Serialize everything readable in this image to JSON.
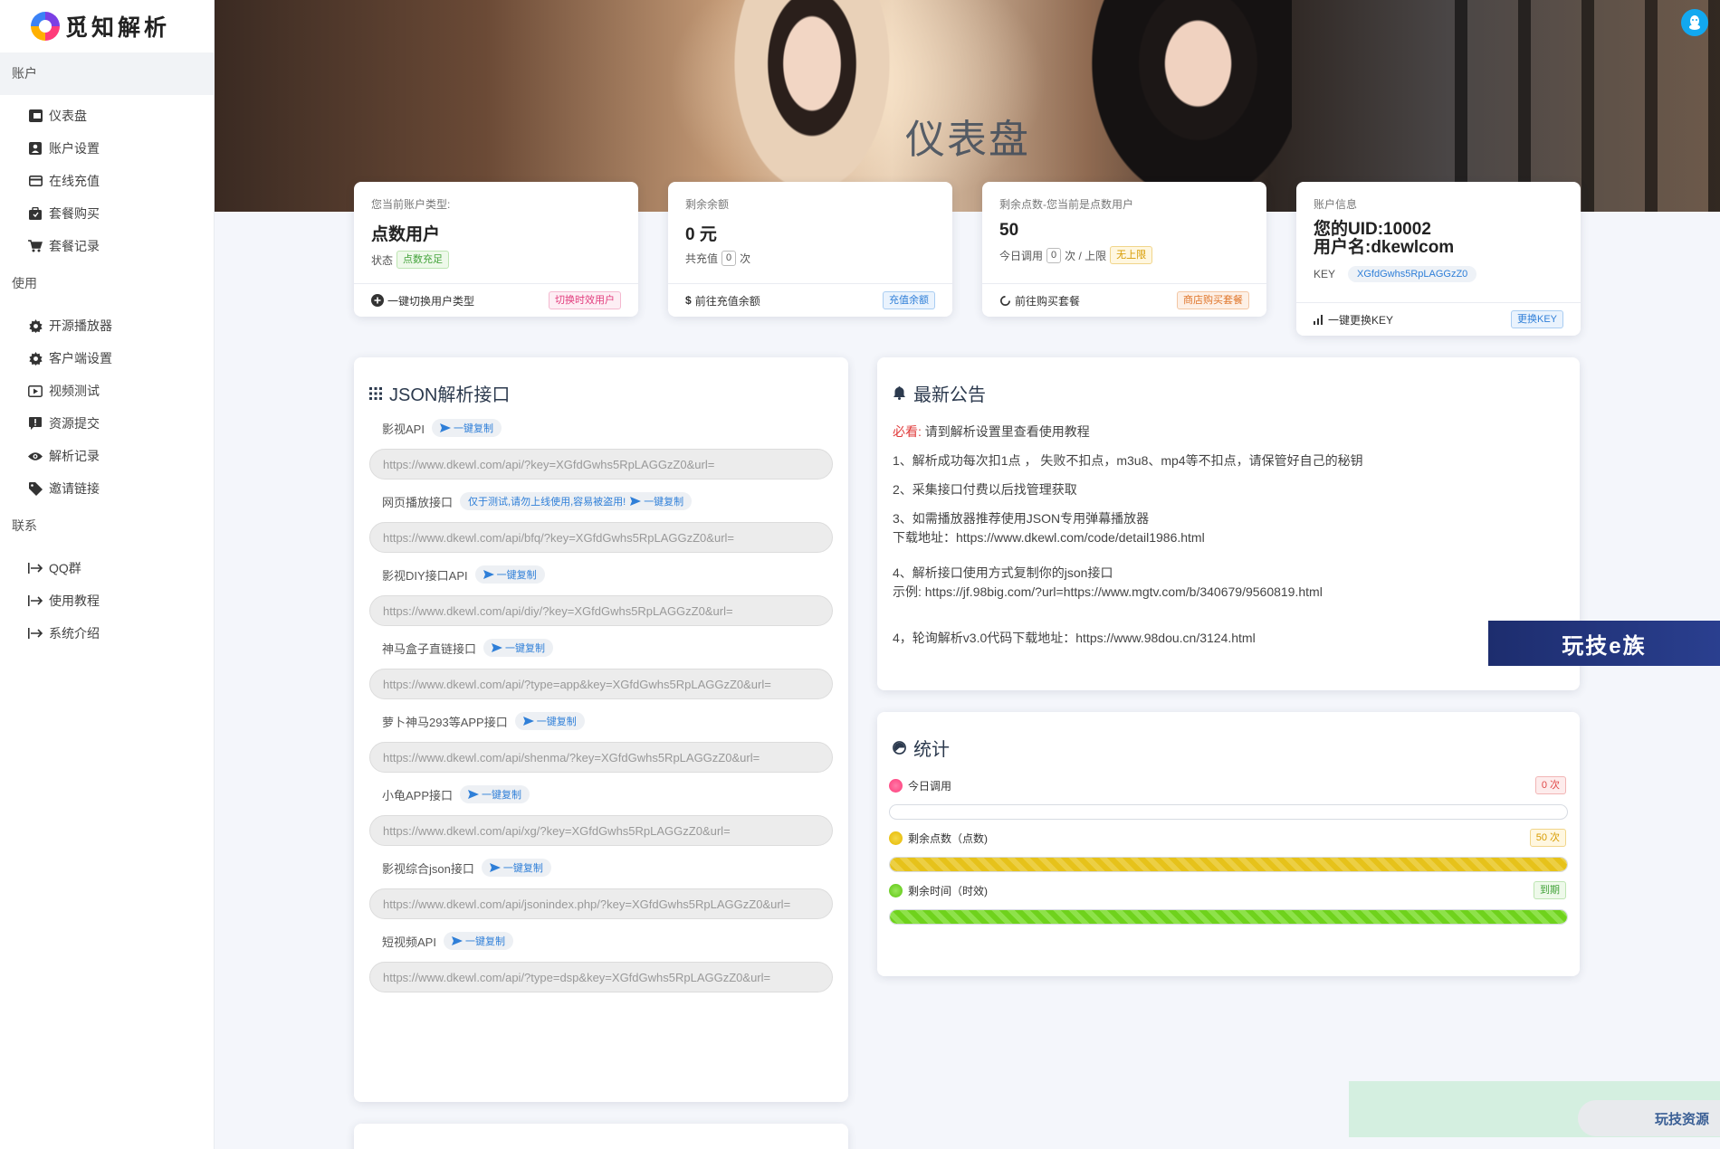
{
  "app": {
    "logo_text": "觅知解析"
  },
  "sidebar": {
    "sections": [
      {
        "label": "账户",
        "items": [
          {
            "label": "仪表盘",
            "icon": "dashboard-icon"
          },
          {
            "label": "账户设置",
            "icon": "user-icon"
          },
          {
            "label": "在线充值",
            "icon": "card-icon"
          },
          {
            "label": "套餐购买",
            "icon": "bag-icon"
          },
          {
            "label": "套餐记录",
            "icon": "cart-icon"
          }
        ]
      },
      {
        "label": "使用",
        "items": [
          {
            "label": "开源播放器",
            "icon": "gear-icon"
          },
          {
            "label": "客户端设置",
            "icon": "gear-icon"
          },
          {
            "label": "视频测试",
            "icon": "play-icon"
          },
          {
            "label": "资源提交",
            "icon": "alert-icon"
          },
          {
            "label": "解析记录",
            "icon": "eye-icon"
          },
          {
            "label": "邀请链接",
            "icon": "tag-icon"
          }
        ]
      },
      {
        "label": "联系",
        "items": [
          {
            "label": "QQ群",
            "icon": "arrow-right-icon"
          },
          {
            "label": "使用教程",
            "icon": "arrow-right-icon"
          },
          {
            "label": "系统介绍",
            "icon": "arrow-right-icon"
          }
        ]
      }
    ]
  },
  "banner": {
    "title": "仪表盘"
  },
  "cards": {
    "account_type": {
      "label": "您当前账户类型:",
      "value": "点数用户",
      "status_label": "状态",
      "status_tag": "点数充足",
      "footer_label": "一键切换用户类型",
      "footer_tag": "切换时效用户"
    },
    "balance": {
      "label": "剩余余额",
      "value": "0 元",
      "sub_prefix": "共充值",
      "sub_num": "0",
      "sub_suffix": "次",
      "footer_label": "前往充值余额",
      "footer_tag": "充值余额"
    },
    "points": {
      "label": "剩余点数-您当前是点数用户",
      "value": "50",
      "sub_prefix": "今日调用",
      "sub_num": "0",
      "sub_mid": "次 / 上限",
      "sub_tag": "无上限",
      "footer_label": "前往购买套餐",
      "footer_tag": "商店购买套餐"
    },
    "account_info": {
      "label": "账户信息",
      "uid_line": "您的UID:10002",
      "name_line": "用户名:dkewlcom",
      "key_label": "KEY",
      "key_value": "XGfdGwhs5RpLAGGzZ0",
      "footer_label": "一键更换KEY",
      "footer_tag": "更换KEY"
    }
  },
  "api": {
    "title": "JSON解析接口",
    "copy_label": "一键复制",
    "items": [
      {
        "name": "影视API",
        "note": "",
        "url": "https://www.dkewl.com/api/?key=XGfdGwhs5RpLAGGzZ0&url="
      },
      {
        "name": "网页播放接口",
        "note": "仅于测试,请勿上线使用,容易被盗用!",
        "url": "https://www.dkewl.com/api/bfq/?key=XGfdGwhs5RpLAGGzZ0&url="
      },
      {
        "name": "影视DIY接口API",
        "note": "",
        "url": "https://www.dkewl.com/api/diy/?key=XGfdGwhs5RpLAGGzZ0&url="
      },
      {
        "name": "神马盒子直链接口",
        "note": "",
        "url": "https://www.dkewl.com/api/?type=app&key=XGfdGwhs5RpLAGGzZ0&url="
      },
      {
        "name": "萝卜神马293等APP接口",
        "note": "",
        "url": "https://www.dkewl.com/api/shenma/?key=XGfdGwhs5RpLAGGzZ0&url="
      },
      {
        "name": "小龟APP接口",
        "note": "",
        "url": "https://www.dkewl.com/api/xg/?key=XGfdGwhs5RpLAGGzZ0&url="
      },
      {
        "name": "影视综合json接口",
        "note": "",
        "url": "https://www.dkewl.com/api/jsonindex.php/?key=XGfdGwhs5RpLAGGzZ0&url="
      },
      {
        "name": "短视频API",
        "note": "",
        "url": "https://www.dkewl.com/api/?type=dsp&key=XGfdGwhs5RpLAGGzZ0&url="
      }
    ]
  },
  "notice": {
    "title": "最新公告",
    "must_label": "必看:",
    "must_text": "请到解析设置里查看使用教程",
    "line1": "1、解析成功每次扣1点 ， 失败不扣点，m3u8、mp4等不扣点，请保管好自己的秘钥",
    "line2": "2、采集接口付费以后找管理获取",
    "line3a": "3、如需播放器推荐使用JSON专用弹幕播放器",
    "line3b": "下载地址：https://www.dkewl.com/code/detail1986.html",
    "line4a": "4、解析接口使用方式复制你的json接口",
    "line4b": "示例:   https://jf.98big.com/?url=https://www.mgtv.com/b/340679/9560819.html",
    "line5": "4，轮询解析v3.0代码下载地址：https://www.98dou.cn/3124.html"
  },
  "stats": {
    "title": "统计",
    "rows": [
      {
        "label": "今日调用",
        "badge": "0 次",
        "fill": 0,
        "color": "#ff4f8b"
      },
      {
        "label": "剩余点数（点数)",
        "badge": "50 次",
        "fill": 1,
        "color": "#e6c21a"
      },
      {
        "label": "剩余时间（时效)",
        "badge": "到期",
        "fill": 1,
        "color": "#6fd21c"
      }
    ]
  },
  "watermarks": {
    "wm1": "玩技e族",
    "wm2": "玩技资源"
  }
}
